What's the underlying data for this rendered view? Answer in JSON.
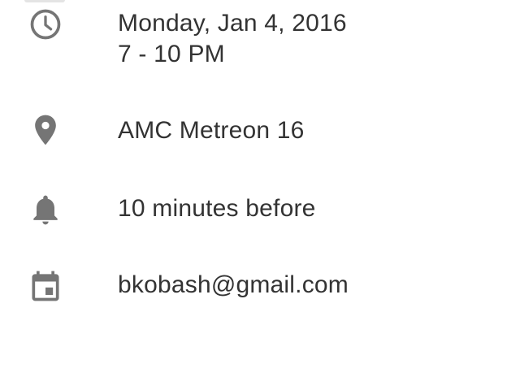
{
  "event_details": {
    "datetime": {
      "icon": "clock-icon",
      "date": "Monday, Jan 4, 2016",
      "time": "7 - 10 PM"
    },
    "location": {
      "icon": "location-pin-icon",
      "label": "AMC Metreon 16"
    },
    "reminder": {
      "icon": "bell-icon",
      "label": "10 minutes before"
    },
    "calendar": {
      "icon": "calendar-icon",
      "label": "bkobash@gmail.com"
    }
  },
  "colors": {
    "icon": "#757575",
    "text": "#333333",
    "background": "#ffffff"
  }
}
